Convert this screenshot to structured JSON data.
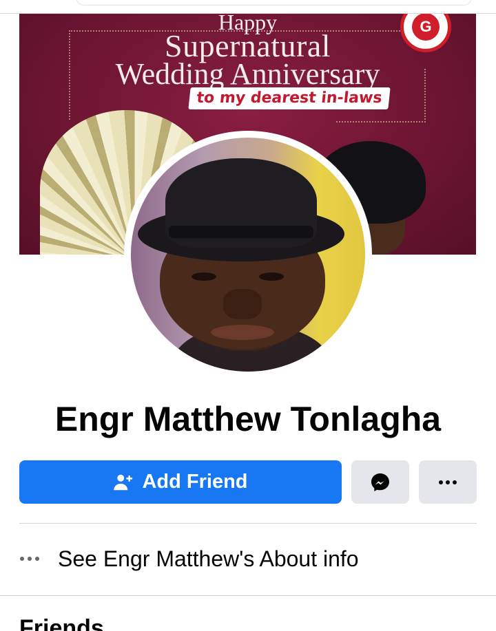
{
  "cover": {
    "line1": "Happy",
    "line2": "Supernatural",
    "line3": "Wedding Anniversary",
    "banner": "to my dearest in-laws",
    "logo_text": "G"
  },
  "profile": {
    "name": "Engr Matthew Tonlagha"
  },
  "actions": {
    "add_friend_label": "Add Friend",
    "messenger_icon": "messenger-icon",
    "more_icon": "more-dots-icon",
    "primary_color": "#1877f2",
    "secondary_color": "#e4e6eb"
  },
  "about": {
    "label": "See Engr Matthew's About info"
  },
  "friends": {
    "title": "Friends"
  }
}
